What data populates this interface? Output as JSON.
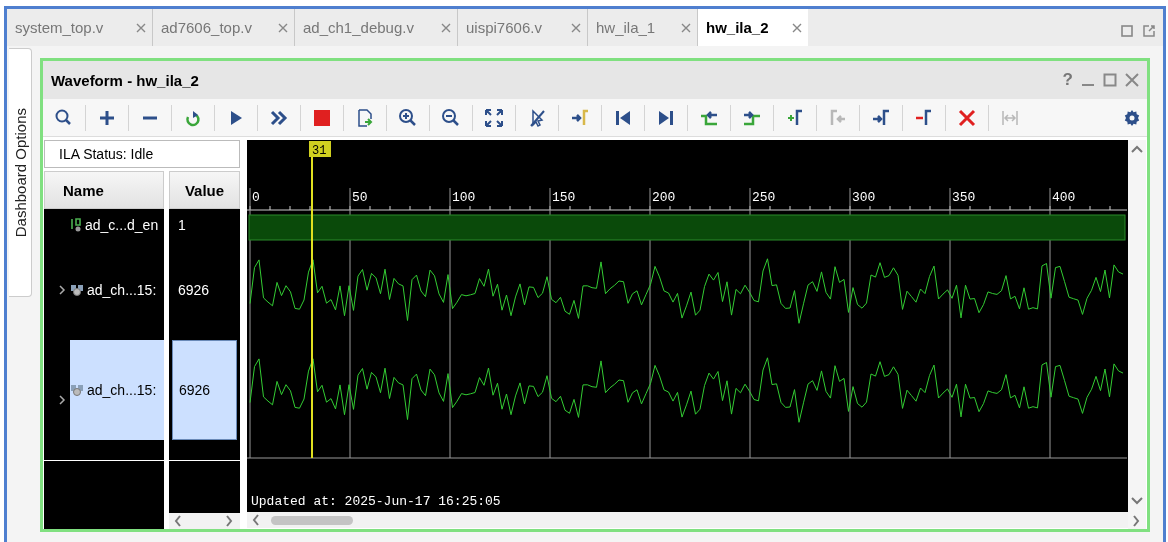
{
  "tabs": [
    {
      "label": "system_top.v",
      "selected": false
    },
    {
      "label": "ad7606_top.v",
      "selected": false
    },
    {
      "label": "ad_ch1_debug.v",
      "selected": false
    },
    {
      "label": "uispi7606.v",
      "selected": false
    },
    {
      "label": "hw_ila_1",
      "selected": false
    },
    {
      "label": "hw_ila_2",
      "selected": true
    }
  ],
  "side_tab": {
    "label": "Dashboard Options"
  },
  "panel": {
    "title": "Waveform - hw_ila_2",
    "help_label": "?"
  },
  "toolbar": [
    {
      "kind": "search",
      "disabled": false
    },
    {
      "kind": "plus",
      "disabled": false
    },
    {
      "kind": "minus",
      "disabled": false
    },
    {
      "kind": "refresh",
      "disabled": false
    },
    {
      "kind": "play",
      "disabled": false
    },
    {
      "kind": "double-chevron",
      "disabled": false
    },
    {
      "kind": "stop",
      "disabled": false
    },
    {
      "kind": "export",
      "disabled": false
    },
    {
      "kind": "zoom-in",
      "disabled": false
    },
    {
      "kind": "zoom-out",
      "disabled": false
    },
    {
      "kind": "expand",
      "disabled": false
    },
    {
      "kind": "crossed-cursor",
      "disabled": false
    },
    {
      "kind": "arrow-bracket",
      "disabled": false
    },
    {
      "kind": "skip-start",
      "disabled": false
    },
    {
      "kind": "skip-end",
      "disabled": false
    },
    {
      "kind": "step-left",
      "disabled": false
    },
    {
      "kind": "step-right",
      "disabled": false
    },
    {
      "kind": "add-marker",
      "disabled": false
    },
    {
      "kind": "marker-left",
      "disabled": true
    },
    {
      "kind": "marker-right",
      "disabled": false
    },
    {
      "kind": "remove-marker",
      "disabled": false
    },
    {
      "kind": "delete",
      "disabled": false
    },
    {
      "kind": "bracket-span",
      "disabled": true
    }
  ],
  "status": "ILA Status: Idle",
  "columns": [
    "Name",
    "Value"
  ],
  "signals": [
    {
      "kind": "digital",
      "name": "ad_c...d_en",
      "value": "1",
      "selected": false
    },
    {
      "kind": "analog",
      "name": "ad_ch...15:",
      "value": "6926",
      "expanded": false,
      "selected": false
    },
    {
      "kind": "analog",
      "name": "ad_ch...15:",
      "value": "6926",
      "expanded": false,
      "selected": true
    }
  ],
  "waveform": {
    "marker_label": "31",
    "ruler_labels": [
      "0",
      "50",
      "100",
      "150",
      "200",
      "250",
      "300",
      "350",
      "400"
    ],
    "updated": "Updated at: 2025-Jun-17 16:25:05"
  }
}
